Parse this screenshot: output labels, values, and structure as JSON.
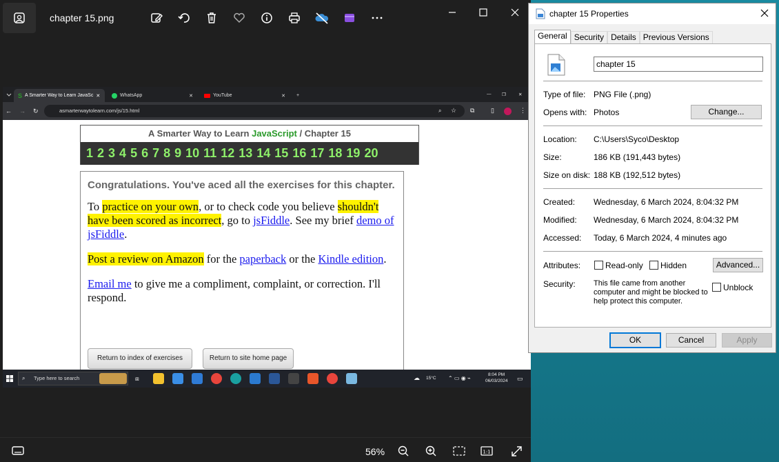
{
  "photos": {
    "filename": "chapter 15.png",
    "zoom": "56%"
  },
  "browser": {
    "tabs": [
      "A Smarter Way to Learn JavaSc",
      "WhatsApp",
      "YouTube"
    ],
    "url": "asmarterwaytolearn.com/js/15.html"
  },
  "page": {
    "title_prefix": "A Smarter Way to Learn",
    "title_js": "JavaScript",
    "title_sep": "/",
    "title_chapter": "Chapter 15",
    "chapters": [
      "1",
      "2",
      "3",
      "4",
      "5",
      "6",
      "7",
      "8",
      "9",
      "10",
      "11",
      "12",
      "13",
      "14",
      "15",
      "16",
      "17",
      "18",
      "19",
      "20"
    ],
    "congrats": "Congratulations. You've aced all the exercises for this chapter.",
    "p1_a": "To ",
    "p1_hl1": "practice on your own",
    "p1_b": ", or to check code you believe ",
    "p1_hl2": "shouldn't have been scored as incorrect",
    "p1_c": ", go to ",
    "p1_link1": "jsFiddle",
    "p1_d": ". See my brief ",
    "p1_link2": "demo of jsFiddle",
    "p1_e": ".",
    "p2_hl": "Post a review on Amazon",
    "p2_a": " for the ",
    "p2_link1": "paperback",
    "p2_b": " or the ",
    "p2_link2": "Kindle edition",
    "p2_c": ".",
    "p3_link": "Email me",
    "p3_a": " to give me a compliment, complaint, or correction. I'll respond.",
    "btn_index": "Return to index of exercises",
    "btn_home": "Return to site home page"
  },
  "taskbar": {
    "search_placeholder": "Type here to search",
    "temp": "15°C",
    "time": "8:04 PM",
    "date": "06/03/2024"
  },
  "props": {
    "title": "chapter 15 Properties",
    "tabs": [
      "General",
      "Security",
      "Details",
      "Previous Versions"
    ],
    "name": "chapter 15",
    "type_label": "Type of file:",
    "type_value": "PNG File (.png)",
    "opens_label": "Opens with:",
    "opens_value": "Photos",
    "change_btn": "Change...",
    "location_label": "Location:",
    "location_value": "C:\\Users\\Syco\\Desktop",
    "size_label": "Size:",
    "size_value": "186 KB (191,443 bytes)",
    "disk_label": "Size on disk:",
    "disk_value": "188 KB (192,512 bytes)",
    "created_label": "Created:",
    "created_value": "Wednesday, 6 March 2024, 8:04:32 PM",
    "modified_label": "Modified:",
    "modified_value": "Wednesday, 6 March 2024, 8:04:32 PM",
    "accessed_label": "Accessed:",
    "accessed_value": "Today, 6 March 2024, 4 minutes ago",
    "attributes_label": "Attributes:",
    "readonly_label": "Read-only",
    "hidden_label": "Hidden",
    "advanced_btn": "Advanced...",
    "security_label": "Security:",
    "security_text": "This file came from another computer and might be blocked to help protect this computer.",
    "unblock_label": "Unblock",
    "ok": "OK",
    "cancel": "Cancel",
    "apply": "Apply"
  }
}
